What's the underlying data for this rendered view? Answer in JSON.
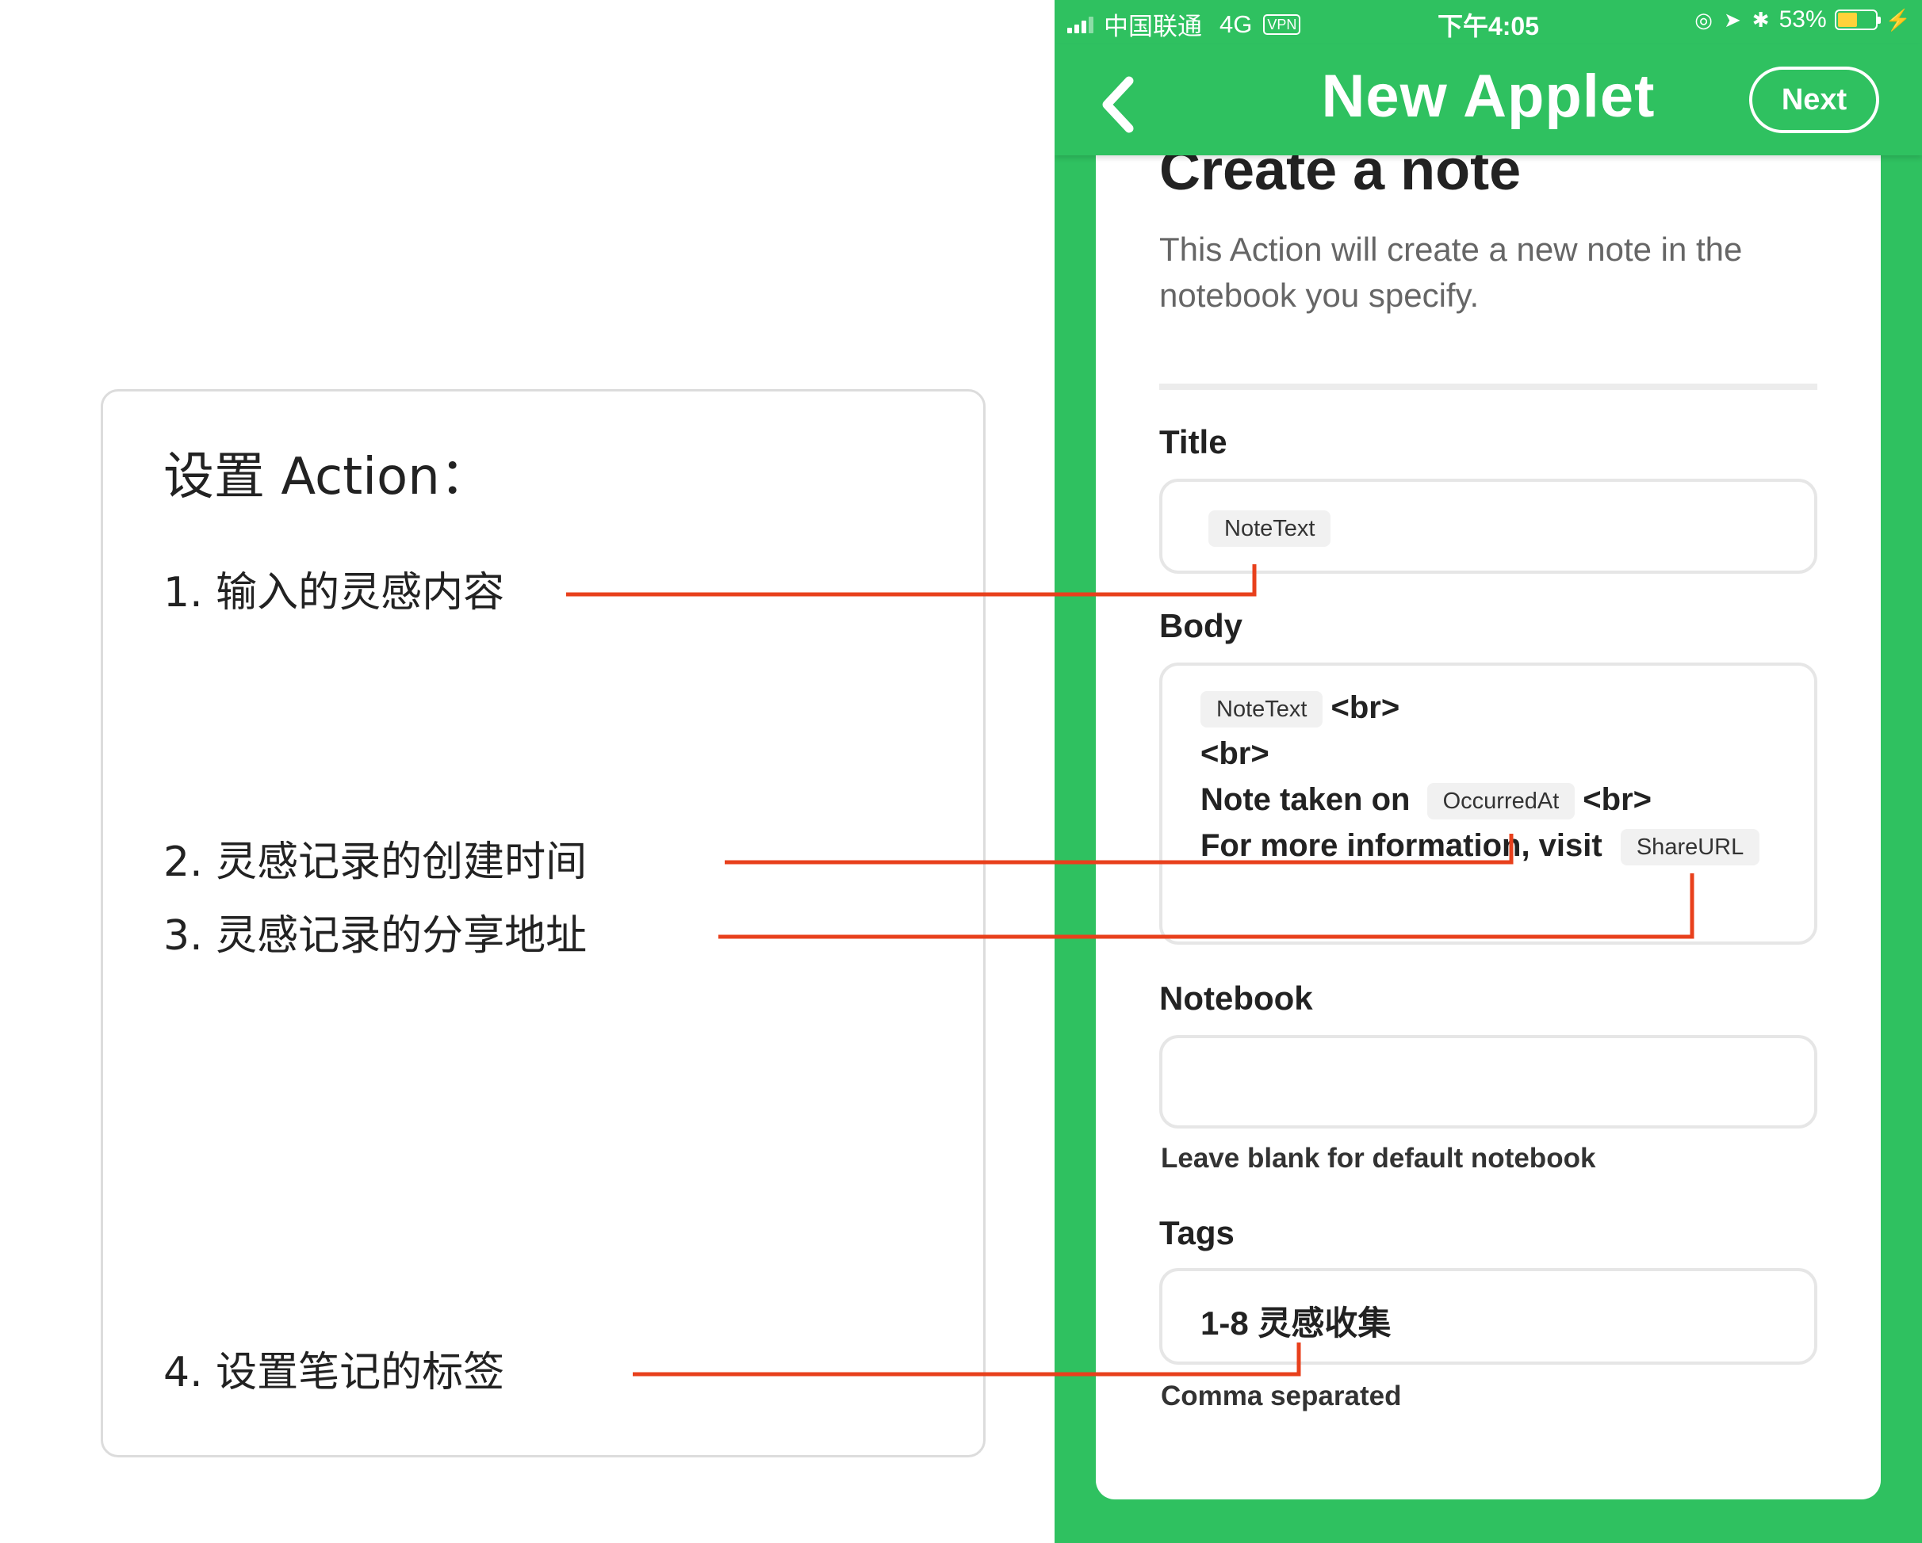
{
  "annotation": {
    "heading": "设置 Action：",
    "items": [
      "1. 输入的灵感内容",
      "2. 灵感记录的创建时间",
      "3. 灵感记录的分享地址",
      "4. 设置笔记的标签"
    ],
    "line_color": "#e8401c"
  },
  "statusbar": {
    "carrier": "中国联通",
    "network": "4G",
    "vpn": "VPN",
    "time": "下午4:05",
    "battery": "53%",
    "battery_level": 0.53
  },
  "navbar": {
    "title": "New Applet",
    "next_label": "Next",
    "back_icon": "chevron-left-icon"
  },
  "action": {
    "title": "Create a note",
    "description": "This Action will create a new note in the notebook you specify."
  },
  "fields": {
    "title": {
      "label": "Title",
      "ingredient": "NoteText"
    },
    "body": {
      "label": "Body",
      "ingredient_1": "NoteText",
      "br": "<br>",
      "note_taken_on": "Note taken on",
      "ingredient_2": "OccurredAt",
      "more_info": "For more information, visit",
      "ingredient_3": "ShareURL"
    },
    "notebook": {
      "label": "Notebook",
      "value": "",
      "helper": "Leave blank for default notebook"
    },
    "tags": {
      "label": "Tags",
      "value": "1-8 灵感收集",
      "helper": "Comma separated"
    }
  },
  "colors": {
    "green": "#2fc160",
    "annotation_line": "#e8401c",
    "battery": "#ffd23a"
  }
}
